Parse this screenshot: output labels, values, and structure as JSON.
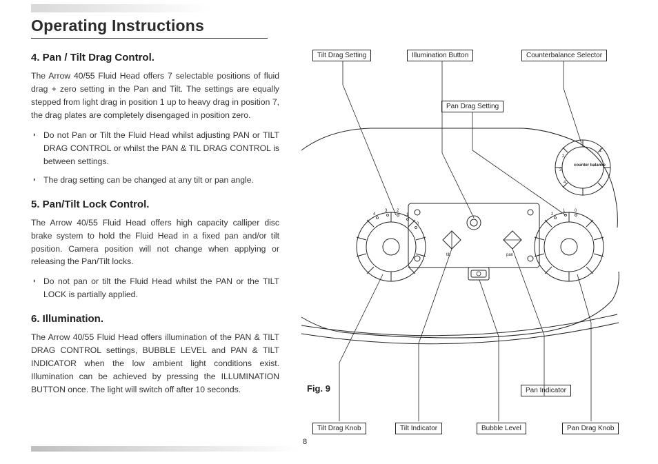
{
  "page": {
    "title": "Operating Instructions",
    "number": "8"
  },
  "sections": {
    "s4": {
      "heading": "4. Pan / Tilt Drag Control.",
      "p1": "The Arrow 40/55 Fluid Head offers 7 selectable positions of fluid drag + zero setting in the Pan and Tilt. The settings are equally stepped from light drag in position 1 up to heavy drag in position 7, the drag plates are completely disengaged in position zero.",
      "b1": "Do not Pan or Tilt the Fluid Head whilst adjusting PAN or TILT DRAG CONTROL or whilst the PAN & TIL DRAG CONTROL is between settings.",
      "b2": "The drag setting can be changed at any tilt or pan angle."
    },
    "s5": {
      "heading": "5. Pan/Tilt Lock Control.",
      "p1": "The Arrow 40/55 Fluid Head offers high capacity calliper disc brake system to hold the Fluid Head in a fixed pan and/or tilt position. Camera position will not change when applying or releasing the Pan/Tilt locks.",
      "b1": "Do not pan or tilt the Fluid Head whilst the PAN or the TILT LOCK is partially applied."
    },
    "s6": {
      "heading": "6. Illumination.",
      "p1": "The Arrow 40/55 Fluid Head offers illumination of the PAN & TILT DRAG CONTROL settings, BUBBLE LEVEL and PAN & TILT INDICATOR when the low ambient light conditions exist. Illumination can be achieved by pressing the ILLUMINATION BUTTON once. The light will switch off after 10 seconds."
    }
  },
  "figure": {
    "caption": "Fig. 9",
    "callouts": {
      "tilt_drag_setting": "Tilt Drag Setting",
      "illumination_button": "Illumination Button",
      "counterbalance_selector": "Counterbalance Selector",
      "pan_drag_setting": "Pan Drag Setting",
      "tilt_drag_knob": "Tilt Drag Knob",
      "tilt_indicator": "Tilt Indicator",
      "bubble_level": "Bubble Level",
      "pan_indicator": "Pan Indicator",
      "pan_drag_knob": "Pan Drag Knob",
      "cb_label": "counter\nbalance",
      "cb_1": "1",
      "cb_2": "2",
      "cb_3": "3",
      "cb_4": "4",
      "tilt_word": "tilt",
      "pan_word": "pan"
    }
  }
}
